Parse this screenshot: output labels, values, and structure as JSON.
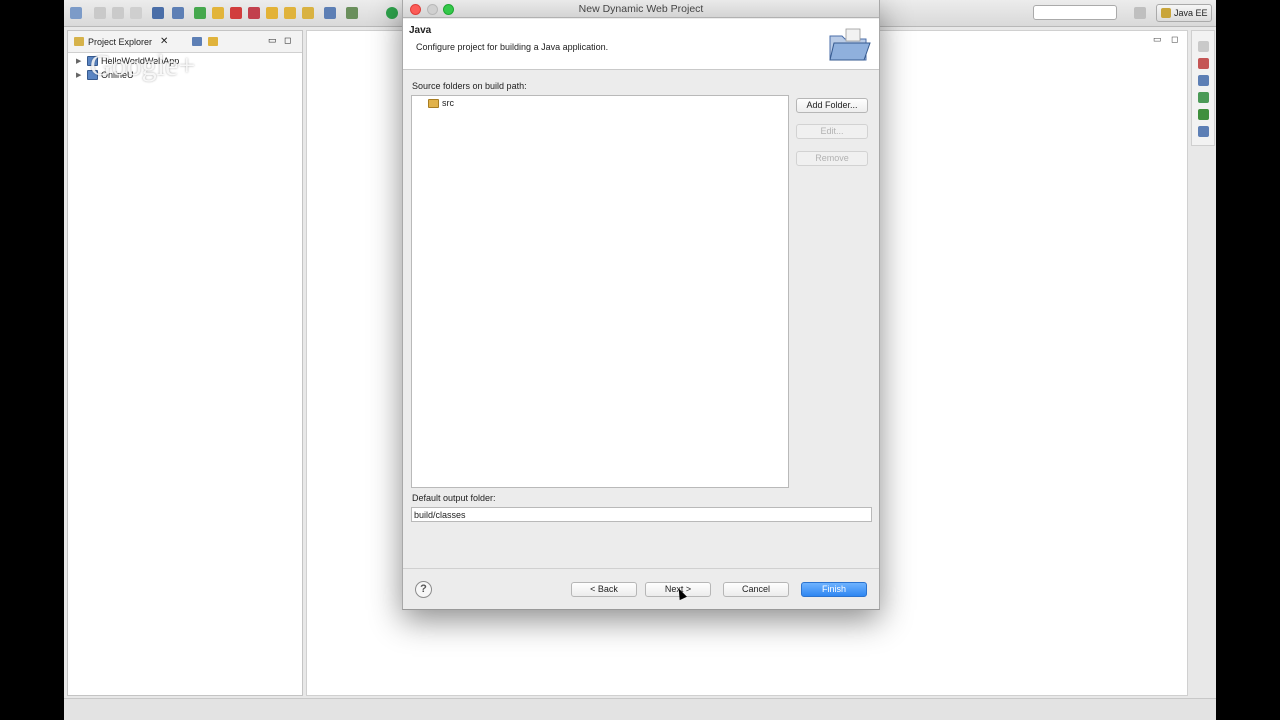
{
  "window": {
    "perspective_label": "Java EE",
    "watermark": "Google+"
  },
  "explorer": {
    "tab_title": "Project Explorer",
    "close_glyph": "✕",
    "items": [
      {
        "label": "HelloWorldWebApp",
        "expander": "▶"
      },
      {
        "label": "OnlineU",
        "expander": "▶"
      }
    ]
  },
  "editor": {
    "minimize_glyph": "▭",
    "maximize_glyph": "◻"
  },
  "dialog": {
    "title": "New Dynamic Web Project",
    "header_title": "Java",
    "header_description": "Configure project for building a Java application.",
    "source_folders_label": "Source folders on build path:",
    "source_folders": [
      "src"
    ],
    "buttons": {
      "add_folder": "Add Folder...",
      "edit": "Edit...",
      "remove": "Remove"
    },
    "output_folder_label": "Default output folder:",
    "output_folder_value": "build/classes",
    "help_glyph": "?",
    "nav": {
      "back": "< Back",
      "next": "Next >",
      "cancel": "Cancel",
      "finish": "Finish"
    }
  },
  "icons": {
    "toolbar": [
      "new-wizard-icon",
      "save-icon",
      "save-all-icon",
      "print-icon",
      "console-icon",
      "debug-icon",
      "resume-icon",
      "suspend-icon",
      "terminate-icon",
      "disconnect-icon",
      "step-into-icon",
      "step-over-icon",
      "step-return-icon",
      "task-icon",
      "server-icon",
      "run-icon"
    ],
    "colors": {
      "finish_button": "#2f86f1",
      "close_traffic": "#fc5b57",
      "min_traffic": "#d0d0d0",
      "zoom_traffic": "#34c84a"
    }
  }
}
